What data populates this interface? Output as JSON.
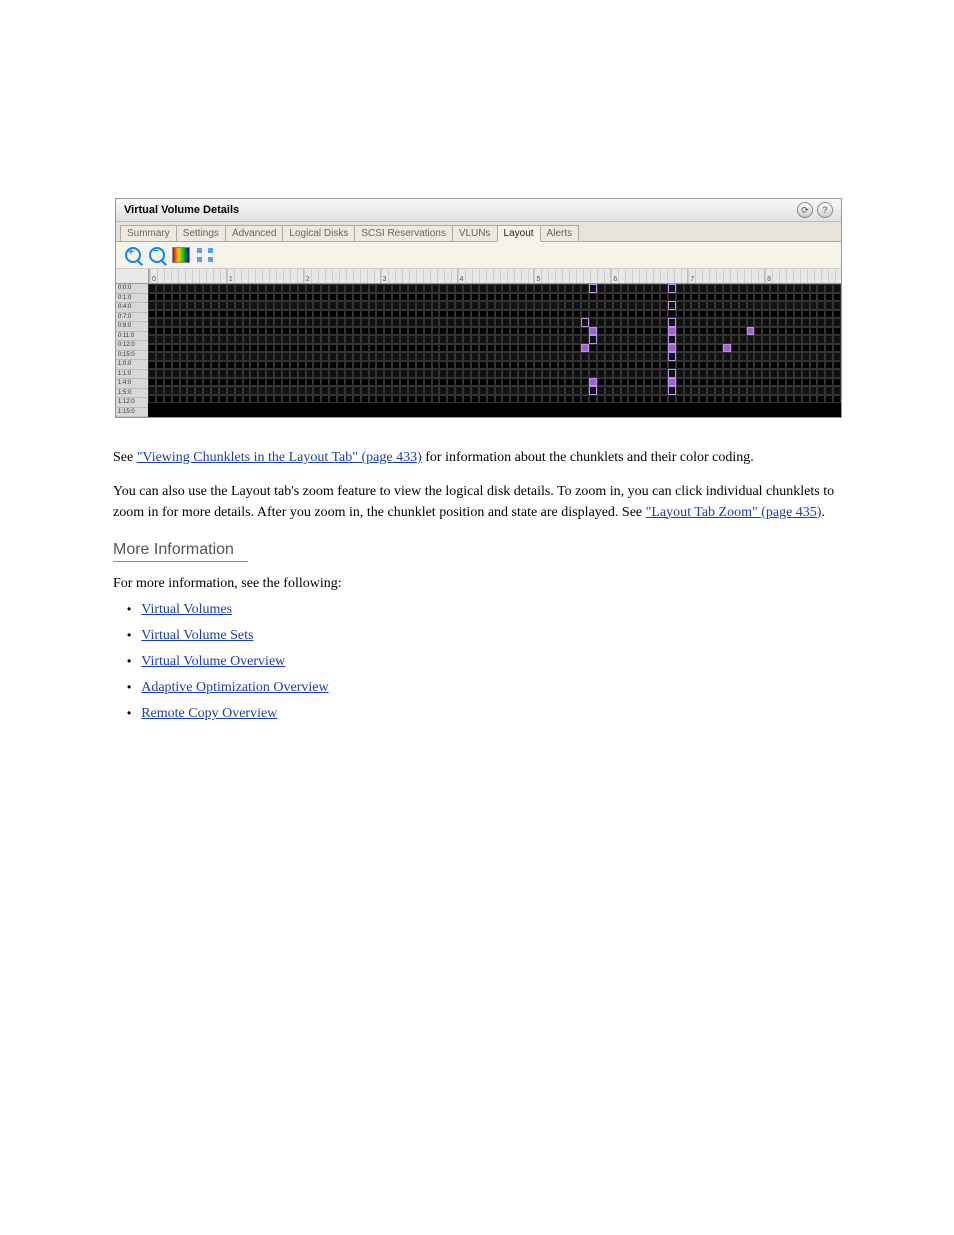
{
  "panel": {
    "title": "Virtual Volume Details",
    "tabs": [
      "Summary",
      "Settings",
      "Advanced",
      "Logical Disks",
      "SCSI Reservations",
      "VLUNs",
      "Layout",
      "Alerts"
    ],
    "active_tab": 6,
    "row_labels": [
      "0:0:0",
      "0:1:0",
      "0:4:0",
      "0:7:0",
      "0:8:0",
      "0:11:0",
      "0:12:0",
      "0:15:0",
      "1:0:0",
      "1:1:0",
      "1:4:0",
      "1:5:0",
      "1:12:0",
      "1:15:0"
    ],
    "ruler_majors": [
      "0",
      "1",
      "2",
      "3",
      "4",
      "5",
      "6",
      "7",
      "8"
    ],
    "cols_per_row": 88,
    "highlights": [
      {
        "row": 0,
        "col": 56
      },
      {
        "row": 0,
        "col": 66
      },
      {
        "row": 2,
        "col": 66
      },
      {
        "row": 4,
        "col": 55
      },
      {
        "row": 4,
        "col": 66
      },
      {
        "row": 5,
        "col": 56
      },
      {
        "row": 5,
        "col": 66
      },
      {
        "row": 5,
        "col": 76
      },
      {
        "row": 6,
        "col": 56
      },
      {
        "row": 6,
        "col": 66
      },
      {
        "row": 7,
        "col": 55
      },
      {
        "row": 7,
        "col": 66
      },
      {
        "row": 7,
        "col": 73
      },
      {
        "row": 8,
        "col": 66
      },
      {
        "row": 10,
        "col": 66
      },
      {
        "row": 11,
        "col": 56
      },
      {
        "row": 11,
        "col": 66
      },
      {
        "row": 12,
        "col": 56
      },
      {
        "row": 12,
        "col": 66
      }
    ]
  },
  "doc": {
    "para1_prefix": "See ",
    "para1_link": "\"Viewing Chunklets in the Layout Tab\" (page 433)",
    "para1_suffix": " for information about the chunklets and their color coding.",
    "para2": "You can also use the Layout tab's zoom feature to view the logical disk details. To zoom in, you can click individual chunklets to zoom in for more details. After you zoom in, the chunklet position and state are displayed. See ",
    "para2_link": "\"Layout Tab Zoom\" (page 435)",
    "para2_suffix": ".",
    "section_title": "More Information",
    "more_info_intro": "For more information, see the following:",
    "links": [
      "Virtual Volumes",
      "Virtual Volume Sets",
      "Virtual Volume Overview",
      "Adaptive Optimization Overview",
      "Remote Copy Overview"
    ]
  }
}
